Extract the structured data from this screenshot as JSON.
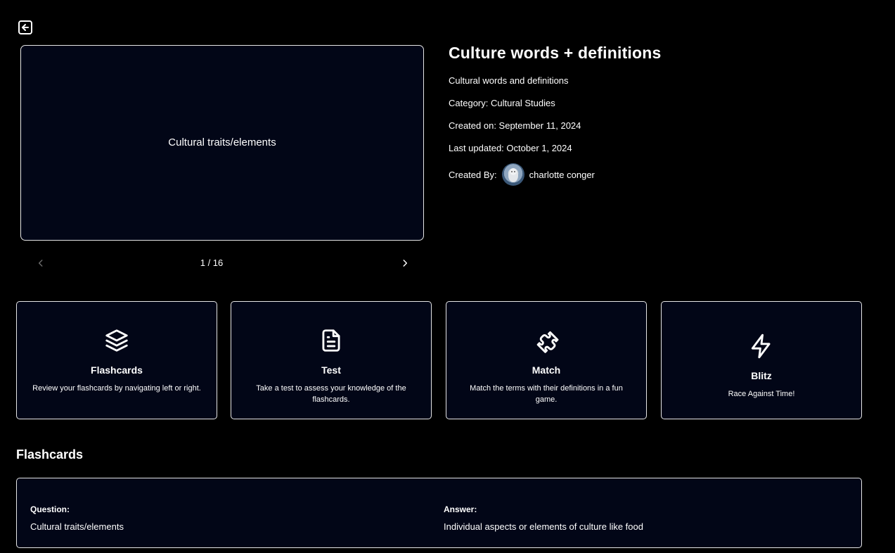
{
  "nav": {
    "back_icon": "arrow-left-square-icon"
  },
  "preview": {
    "card_text": "Cultural traits/elements",
    "counter": "1 / 16",
    "prev_icon": "chevron-left-icon",
    "next_icon": "chevron-right-icon"
  },
  "set": {
    "title": "Culture words + definitions",
    "description": "Cultural words and definitions",
    "category": "Category: Cultural Studies",
    "created_on": "Created on: September 11, 2024",
    "last_updated": "Last updated: October 1, 2024",
    "created_by_label": "Created By:",
    "creator_name": "charlotte conger"
  },
  "modes": [
    {
      "title": "Flashcards",
      "description": "Review your flashcards by navigating left or right.",
      "icon": "layers-icon"
    },
    {
      "title": "Test",
      "description": "Take a test to assess your knowledge of the flashcards.",
      "icon": "document-icon"
    },
    {
      "title": "Match",
      "description": "Match the terms with their definitions in a fun game.",
      "icon": "puzzle-icon"
    },
    {
      "title": "Blitz",
      "description": "Race Against Time!",
      "icon": "lightning-icon"
    }
  ],
  "flashcards_section": {
    "title": "Flashcards",
    "question_label": "Question:",
    "answer_label": "Answer:",
    "cards": [
      {
        "question": "Cultural traits/elements",
        "answer": "Individual aspects or elements of culture like food"
      }
    ]
  },
  "colors": {
    "background": "#000000",
    "card_background": "#020617",
    "border": "#e6e6e6",
    "text": "#ffffff",
    "muted_icon": "#6b6b6b"
  }
}
